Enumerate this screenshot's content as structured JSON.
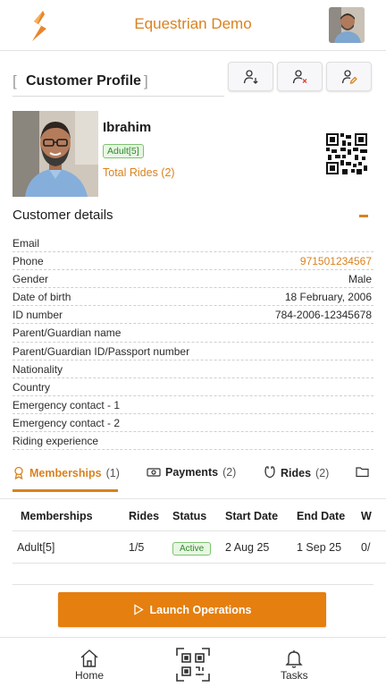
{
  "header": {
    "app_title": "Equestrian Demo"
  },
  "profile": {
    "section_title": "Customer Profile",
    "name": "Ibrahim",
    "membership_badge": "Adult[5]",
    "total_rides": "Total Rides (2)"
  },
  "actions": [
    {
      "icon": "user-download-icon"
    },
    {
      "icon": "user-remove-icon"
    },
    {
      "icon": "user-edit-icon"
    }
  ],
  "details": {
    "title": "Customer details",
    "rows": [
      {
        "label": "Email",
        "value": ""
      },
      {
        "label": "Phone",
        "value": "971501234567"
      },
      {
        "label": "Gender",
        "value": "Male"
      },
      {
        "label": "Date of birth",
        "value": "18 February, 2006"
      },
      {
        "label": "ID number",
        "value": "784-2006-12345678"
      },
      {
        "label": "Parent/Guardian name",
        "value": ""
      },
      {
        "label": "Parent/Guardian ID/Passport number",
        "value": ""
      },
      {
        "label": "Nationality",
        "value": ""
      },
      {
        "label": "Country",
        "value": ""
      },
      {
        "label": "Emergency contact - 1",
        "value": ""
      },
      {
        "label": "Emergency contact - 2",
        "value": ""
      },
      {
        "label": "Riding experience",
        "value": ""
      }
    ]
  },
  "tabs": [
    {
      "label": "Memberships",
      "count": "(1)"
    },
    {
      "label": "Payments",
      "count": "(2)"
    },
    {
      "label": "Rides",
      "count": "(2)"
    }
  ],
  "table": {
    "headers": [
      "Memberships",
      "Rides",
      "Status",
      "Start Date",
      "End Date",
      "W"
    ],
    "rows": [
      {
        "membership": "Adult[5]",
        "rides": "1/5",
        "status": "Active",
        "start": "2 Aug 25",
        "end": "1 Sep 25",
        "w": "0/"
      }
    ]
  },
  "launch_button": "Launch Operations",
  "bottom_nav": {
    "home": "Home",
    "tasks": "Tasks"
  },
  "colors": {
    "accent": "#d9821e",
    "button": "#e57f0f",
    "badge_green": "#2f8a2b"
  }
}
